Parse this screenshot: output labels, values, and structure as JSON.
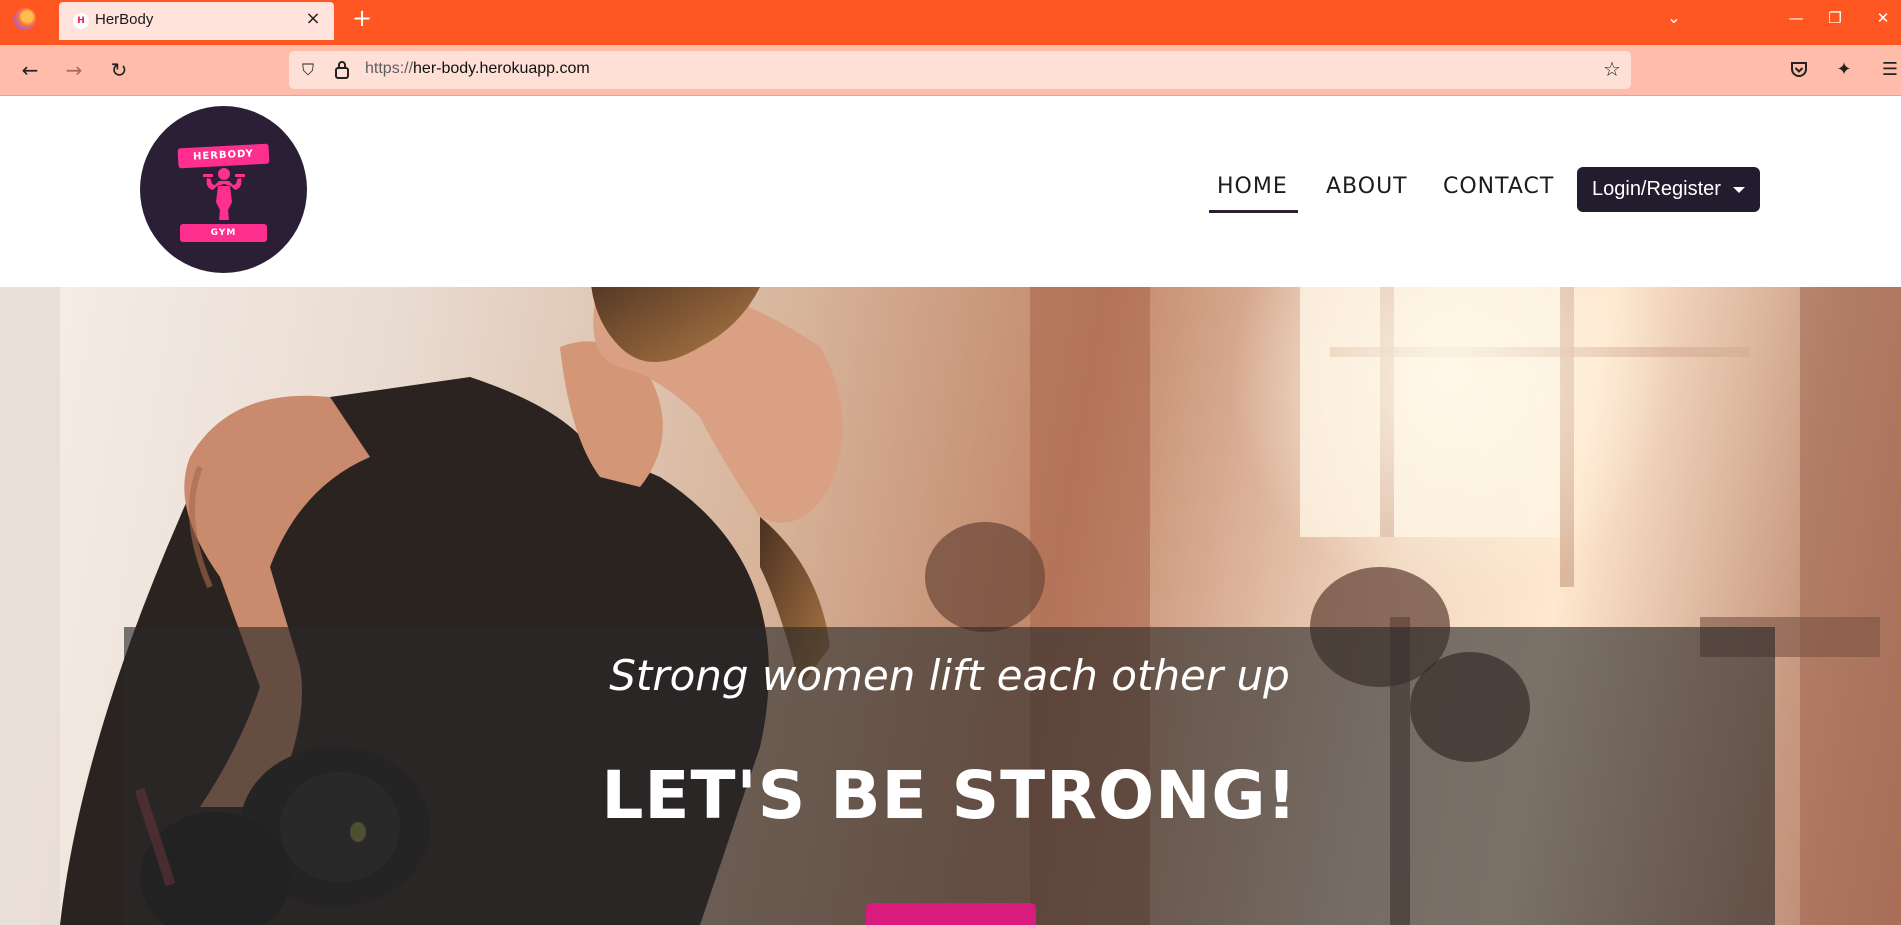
{
  "browser": {
    "tab": {
      "title": "HerBody",
      "favicon_letter": "H",
      "close_glyph": "×"
    },
    "new_tab_glyph": "+",
    "tab_list_glyph": "⌄",
    "window_controls": {
      "minimize": "—",
      "restore": "❐",
      "close": "✕"
    },
    "nav": {
      "back": "←",
      "forward": "→",
      "reload": "↻"
    },
    "url": {
      "scheme": "https://",
      "host": "her-body.herokuapp.com"
    },
    "icons": {
      "shield": "⛉",
      "lock": "🔒",
      "star": "☆",
      "pocket": "⛉",
      "extensions": "✦",
      "menu": "☰"
    }
  },
  "site": {
    "logo": {
      "top_text": "HERBODY",
      "bottom_text": "GYM"
    },
    "nav": [
      {
        "label": "HOME",
        "active": true
      },
      {
        "label": "ABOUT",
        "active": false
      },
      {
        "label": "CONTACT",
        "active": false
      }
    ],
    "login_label": "Login/Register"
  },
  "hero": {
    "tagline": "Strong women lift each other up",
    "heading": "LET'S BE STRONG!"
  },
  "colors": {
    "tabbar": "#ff5722",
    "toolbar": "#ffbcaa",
    "brand_dark": "#231b2e",
    "brand_pink": "#ff2f8f",
    "cta_pink": "#d81b7d"
  }
}
